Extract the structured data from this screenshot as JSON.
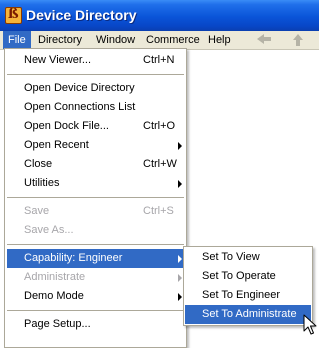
{
  "window": {
    "title": "Device Directory",
    "icon": "app-icon"
  },
  "menubar": {
    "items": [
      {
        "label": "File",
        "active": true
      },
      {
        "label": "Directory"
      },
      {
        "label": "Window"
      },
      {
        "label": "Commerce"
      },
      {
        "label": "Help"
      }
    ],
    "nav": {
      "back_icon": "back-arrow-icon",
      "up_icon": "up-arrow-icon",
      "enabled": false
    }
  },
  "file_menu": {
    "items": [
      {
        "label": "New Viewer...",
        "shortcut": "Ctrl+N"
      },
      {
        "label": "Open Device Directory"
      },
      {
        "label": "Open Connections List"
      },
      {
        "label": "Open Dock File...",
        "shortcut": "Ctrl+O"
      },
      {
        "label": "Open Recent",
        "submenu": true
      },
      {
        "label": "Close",
        "shortcut": "Ctrl+W"
      },
      {
        "label": "Utilities",
        "submenu": true
      },
      {
        "label": "Save",
        "shortcut": "Ctrl+S",
        "disabled": true
      },
      {
        "label": "Save As...",
        "disabled": true
      },
      {
        "label": "Capability: Engineer",
        "submenu": true,
        "highlighted": true
      },
      {
        "label": "Administrate",
        "submenu": true,
        "disabled": true
      },
      {
        "label": "Demo Mode",
        "submenu": true
      },
      {
        "label": "Page Setup..."
      }
    ]
  },
  "capability_submenu": {
    "items": [
      {
        "label": "Set To View"
      },
      {
        "label": "Set To Operate"
      },
      {
        "label": "Set To Engineer"
      },
      {
        "label": "Set To Administrate",
        "highlighted": true
      }
    ]
  },
  "colors": {
    "titlebar": "#0a54d8",
    "menu_highlight": "#316ac5",
    "menubar_bg": "#ece9d8",
    "disabled_text": "#a7a6aa"
  }
}
